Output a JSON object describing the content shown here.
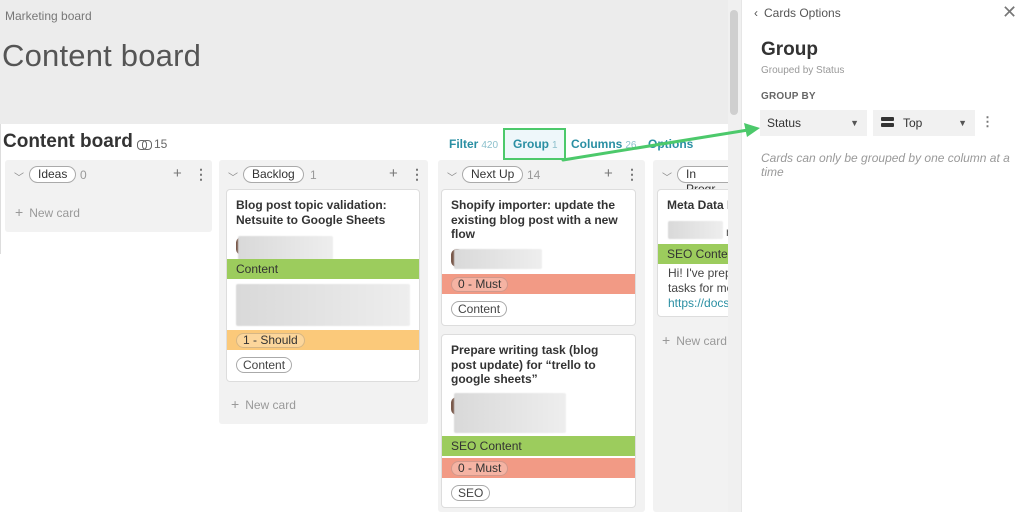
{
  "breadcrumb": "Marketing board",
  "page_title": "Content board",
  "board": {
    "title": "Content board",
    "link_count": "15",
    "toolbar": {
      "filter_label": "Filter",
      "filter_count": "420",
      "group_label": "Group",
      "group_count": "1",
      "columns_label": "Columns",
      "columns_count": "26",
      "options_label": "Options"
    }
  },
  "columns": [
    {
      "name": "Ideas",
      "count": "0"
    },
    {
      "name": "Backlog",
      "count": "1"
    },
    {
      "name": "Next Up",
      "count": "14"
    },
    {
      "name": "In Progr",
      "count": ""
    }
  ],
  "new_card_label": "New card",
  "cards": {
    "backlog_1": {
      "title": "Blog post topic validation: Netsuite to Google Sheets",
      "type_label": "Content",
      "priority_label": "1 - Should",
      "tag": "Content"
    },
    "nextup_1": {
      "title": "Shopify importer: update the existing blog post with a new flow",
      "priority_label": "0 - Must",
      "tag": "Content"
    },
    "nextup_2": {
      "title": "Prepare writing task (blog post update) for “trello to google sheets”",
      "type_label": "SEO  Content",
      "priority_label": "0 - Must",
      "tag": "SEO"
    },
    "inprog_1": {
      "title": "Meta Data I",
      "type_label": "SEO  Conte",
      "body_line1": "Hi! I've prep",
      "body_line2": "tasks for me",
      "body_link": "https://docs",
      "partial_text": "n"
    }
  },
  "panel": {
    "back_label": "Cards Options",
    "heading": "Group",
    "subheading": "Grouped by Status",
    "section_label": "GROUP BY",
    "group_field": "Status",
    "group_position": "Top",
    "note": "Cards can only be grouped by one column at a time"
  },
  "colors": {
    "accent": "#2a8fa3",
    "highlight_box": "#4cc96b",
    "band_green": "#9ccc5d",
    "band_red": "#f29a85",
    "band_orange": "#fbc97a"
  }
}
